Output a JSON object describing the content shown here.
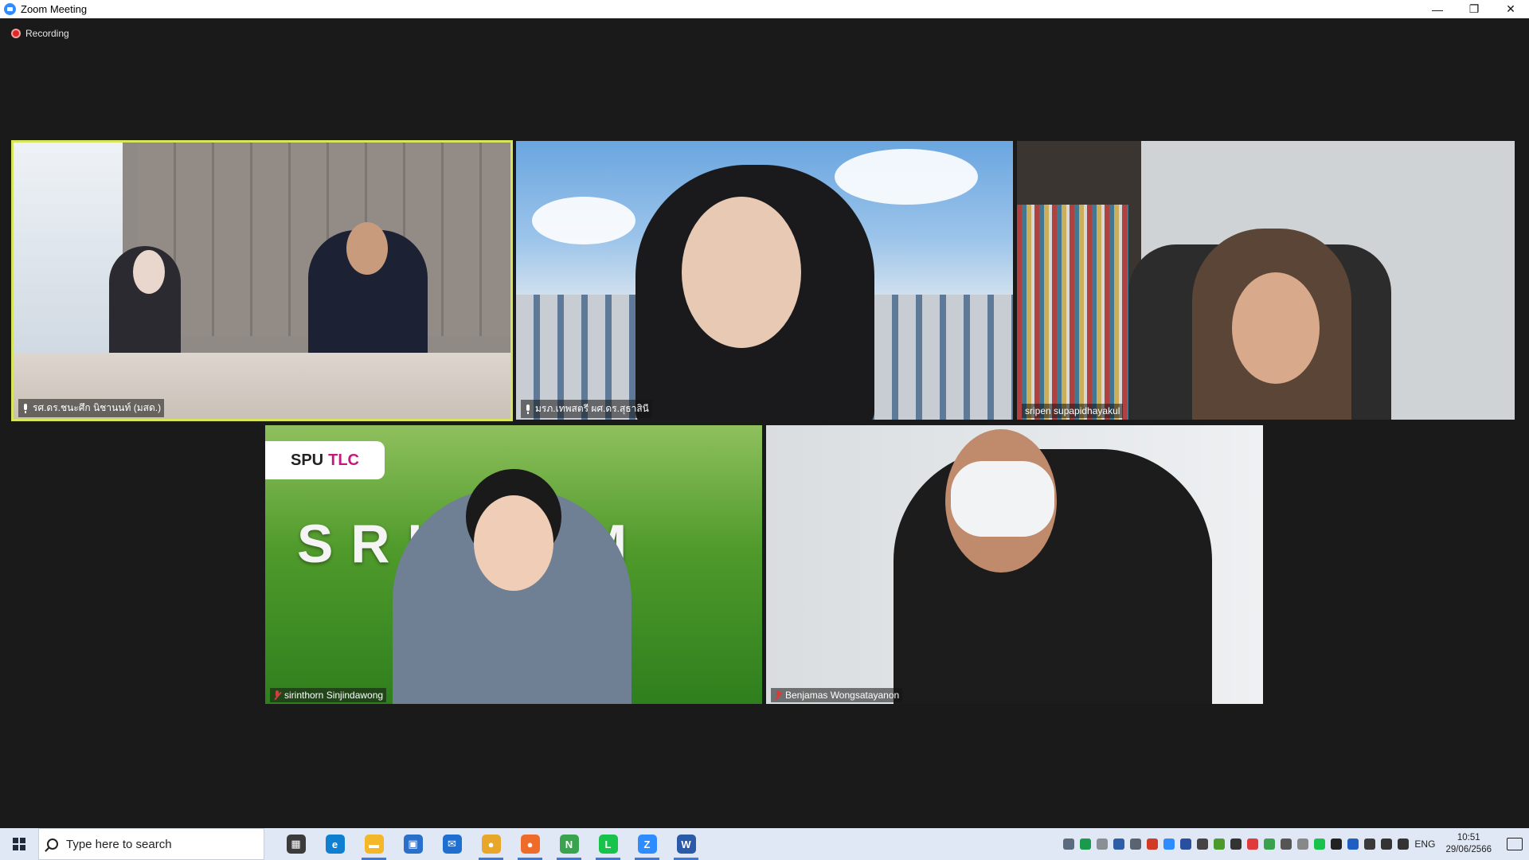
{
  "window": {
    "title": "Zoom Meeting",
    "minimize": "—",
    "maximize": "❐",
    "close": "✕"
  },
  "recording": {
    "label": "Recording",
    "color": "#e02828"
  },
  "participants": [
    {
      "name": "รศ.ดร.ชนะศึก นิชานนท์ (มสด.)",
      "status": "pinned",
      "active_speaker": true
    },
    {
      "name": "มรภ.เทพสตรี ผศ.ดร.สุธาสินี",
      "status": "pinned"
    },
    {
      "name": "sripen supapidhayakul",
      "status": "unmuted"
    },
    {
      "name": "sirinthorn Sinjindawong",
      "status": "muted"
    },
    {
      "name": "Benjamas Wongsatayanon",
      "status": "muted"
    }
  ],
  "backgrounds": {
    "tile4_logo_a": "SPU",
    "tile4_logo_b": "TLC",
    "tile4_sign": "SRIP UM"
  },
  "taskbar": {
    "search_placeholder": "Type here to search",
    "apps": [
      {
        "name": "task-view",
        "glyph": "▦",
        "color": "#3b3b3b"
      },
      {
        "name": "edge",
        "glyph": "e",
        "color": "#0f7fd1"
      },
      {
        "name": "file-explorer",
        "glyph": "▬",
        "color": "#f4b728"
      },
      {
        "name": "store",
        "glyph": "▣",
        "color": "#2a6fc9"
      },
      {
        "name": "mail",
        "glyph": "✉",
        "color": "#1f6fd1"
      },
      {
        "name": "chrome",
        "glyph": "●",
        "color": "#e8a62b"
      },
      {
        "name": "firefox",
        "glyph": "●",
        "color": "#ef6b2a"
      },
      {
        "name": "chrome-profile",
        "glyph": "N",
        "color": "#3aa34d"
      },
      {
        "name": "line",
        "glyph": "L",
        "color": "#17c34a"
      },
      {
        "name": "zoom",
        "glyph": "Z",
        "color": "#2d8cff"
      },
      {
        "name": "word",
        "glyph": "W",
        "color": "#2b5aa8"
      }
    ],
    "language": "ENG",
    "time": "10:51",
    "date": "29/06/2566"
  }
}
